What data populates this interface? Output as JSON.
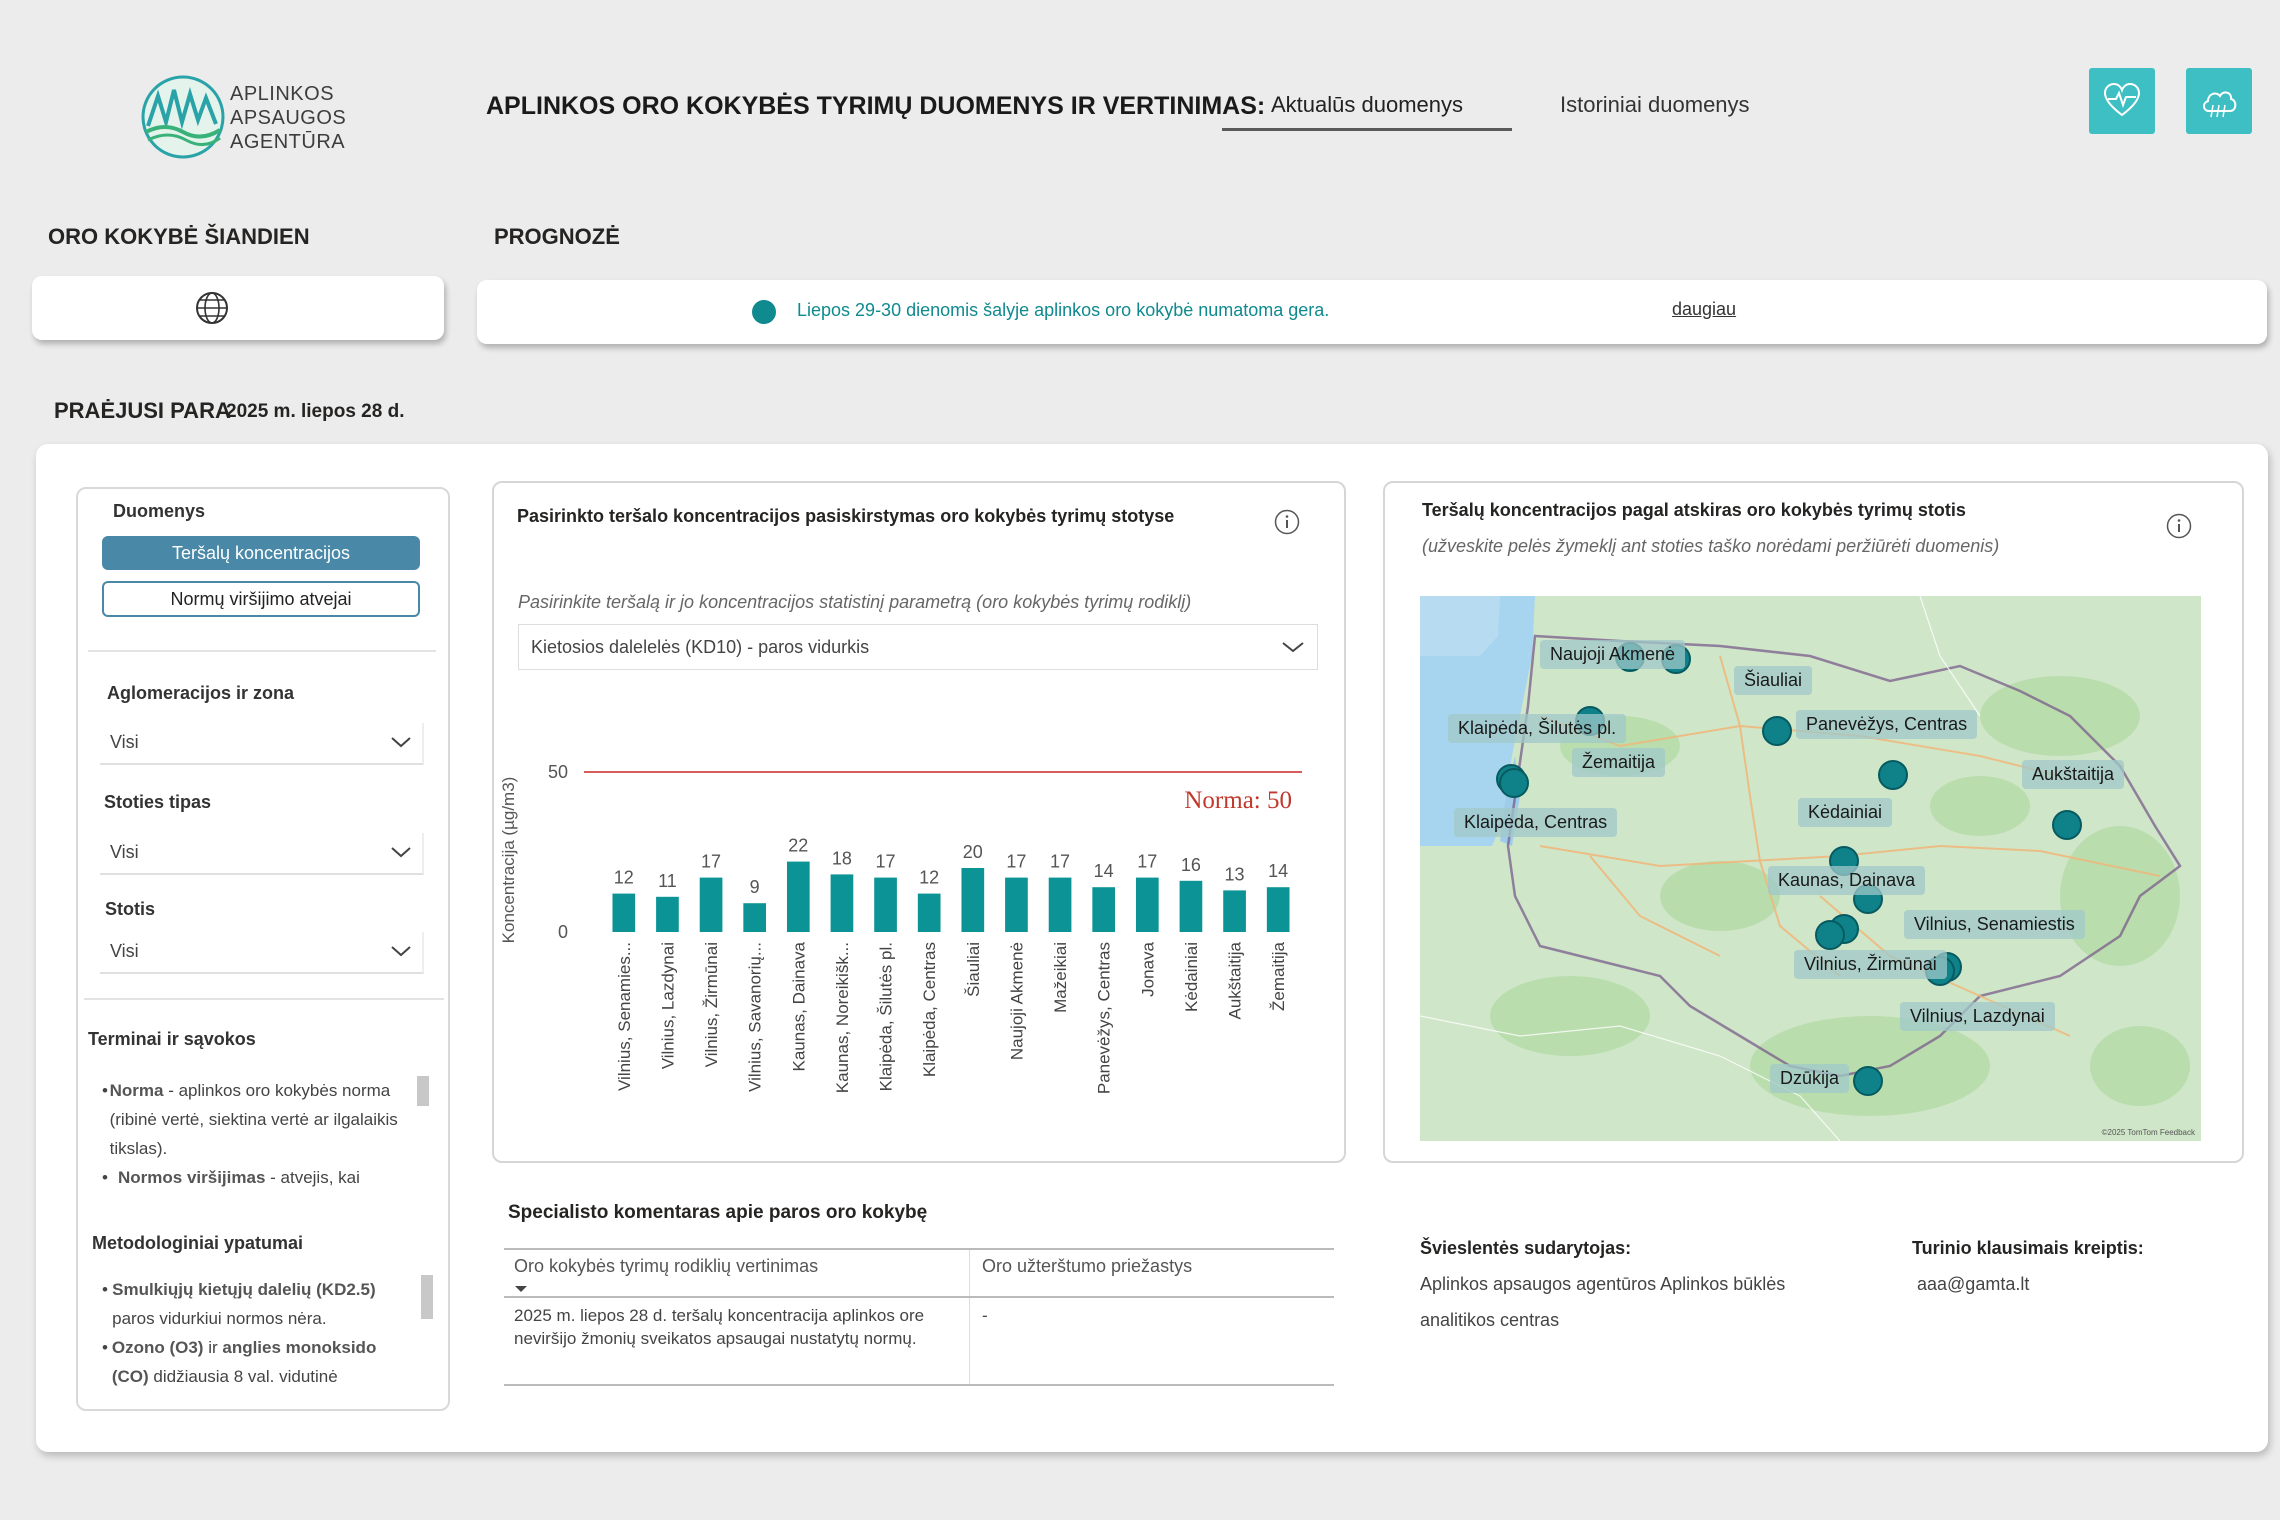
{
  "header": {
    "logo_lines": [
      "APLINKOS",
      "APSAUGOS",
      "AGENTŪRA"
    ],
    "title": "APLINKOS ORO KOKYBĖS TYRIMŲ DUOMENYS IR VERTINIMAS:",
    "tabs": [
      {
        "label": "Aktualūs duomenys",
        "active": true
      },
      {
        "label": "Istoriniai duomenys",
        "active": false
      }
    ],
    "buttons": [
      {
        "icon": "heart-pulse-icon"
      },
      {
        "icon": "cloud-icon"
      }
    ],
    "accent_color": "#3ebfc4"
  },
  "today": {
    "label": "ORO KOKYBĖ ŠIANDIEN",
    "icon": "globe-icon"
  },
  "forecast": {
    "label": "PROGNOZĖ",
    "text": "Liepos 29-30 dienomis šalyje aplinkos oro kokybė numatoma gera.",
    "more": "daugiau",
    "status_color": "#0f8a8f"
  },
  "past_day": {
    "label": "PRAĖJUSI PARA",
    "date": "2025 m. liepos 28 d."
  },
  "filters": {
    "data_label": "Duomenys",
    "data_buttons": [
      "Teršalų koncentracijos",
      "Normų viršijimo atvejai"
    ],
    "agglomeration_label": "Aglomeracijos ir zona",
    "agglomeration_value": "Visi",
    "station_type_label": "Stoties tipas",
    "station_type_value": "Visi",
    "station_label": "Stotis",
    "station_value": "Visi",
    "terms_title": "Terminai ir sąvokos",
    "terms": [
      {
        "term": "Norma",
        "text": " - aplinkos oro kokybės norma (ribinė vertė, siektina vertė ar ilgalaikis tikslas)."
      },
      {
        "term": "Normos viršijimas",
        "text": " -  atvejis, kai"
      }
    ],
    "methods_title": "Metodologiniai ypatumai",
    "methods": [
      {
        "term": "Smulkiųjų kietųjų dalelių (KD2.5)",
        "text": " paros vidurkiui normos nėra."
      },
      {
        "term": "Ozono (O3)",
        "mid": " ir ",
        "term2": "anglies monoksido",
        "term3": "(CO)",
        "text": " didžiausia 8 val. vidutinė"
      }
    ]
  },
  "chart_panel": {
    "title": "Pasirinkto teršalo koncentracijos pasiskirstymas oro kokybės tyrimų stotyse",
    "subtitle": "Pasirinkite teršalą ir jo koncentracijos statistinį parametrą (oro kokybės tyrimų rodiklį)",
    "select_value": "Kietosios dalelelės (KD10) - paros vidurkis"
  },
  "chart_data": {
    "type": "bar",
    "categories": [
      "Vilnius, Senamies...",
      "Vilnius, Lazdynai",
      "Vilnius, Žirmūnai",
      "Vilnius, Savanorių...",
      "Kaunas, Dainava",
      "Kaunas, Noreikišk...",
      "Klaipėda, Šilutės pl.",
      "Klaipėda, Centras",
      "Šiauliai",
      "Naujoji Akmenė",
      "Mažeikiai",
      "Panevėžys, Centras",
      "Jonava",
      "Kėdainiai",
      "Aukštaitija",
      "Žemaitija"
    ],
    "values": [
      12,
      11,
      17,
      9,
      22,
      18,
      17,
      12,
      20,
      17,
      17,
      14,
      17,
      16,
      13,
      14
    ],
    "ylabel": "Koncentracija (µg/m3)",
    "yticks": [
      0,
      50
    ],
    "ylim": [
      0,
      50
    ],
    "norm_value": 50,
    "norm_label": "Norma: 50",
    "bar_color": "#0b9396",
    "norm_color": "#d65c5c"
  },
  "map_panel": {
    "title": "Teršalų koncentracijos pagal atskiras oro kokybės tyrimų stotis",
    "subtitle": "(užveskite pelės žymeklį ant stoties taško norėdami peržiūrėti duomenis)",
    "credit": "©2025 TomTom Feedback",
    "stations": [
      "Naujoji Akmenė",
      "Šiauliai",
      "Klaipėda, Šilutės pl.",
      "Panevėžys, Centras",
      "Žemaitija",
      "Aukštaitija",
      "Kėdainiai",
      "Klaipėda, Centras",
      "Kaunas, Dainava",
      "Vilnius, Senamiestis",
      "Vilnius, Žirmūnai",
      "Vilnius, Lazdynai",
      "Dzūkija"
    ]
  },
  "comment": {
    "title": "Specialisto komentaras apie paros oro kokybę",
    "col1_header": "Oro kokybės tyrimų rodiklių vertinimas",
    "col2_header": "Oro užterštumo priežastys",
    "col1_value": "2025 m. liepos 28 d. teršalų koncentracija aplinkos ore neviršijo žmonių sveikatos apsaugai nustatytų normų.",
    "col2_value": "-"
  },
  "footer": {
    "author_label": "Švieslentės sudarytojas:",
    "author_value": "Aplinkos apsaugos agentūros Aplinkos būklės analitikos centras",
    "contact_label": "Turinio klausimais kreiptis:",
    "contact_value": "aaa@gamta.lt"
  }
}
